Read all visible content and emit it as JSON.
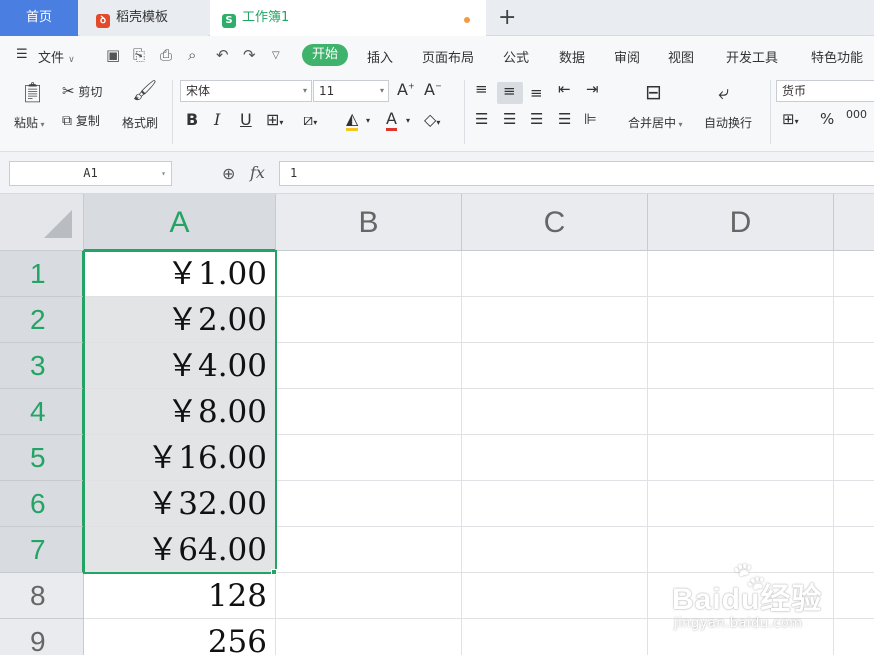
{
  "tabs": {
    "home": "首页",
    "template": "稻壳模板",
    "sheet": "工作簿1",
    "new_tab": "+"
  },
  "menu": {
    "file": "文件",
    "items": [
      "开始",
      "插入",
      "页面布局",
      "公式",
      "数据",
      "审阅",
      "视图",
      "开发工具",
      "特色功能"
    ]
  },
  "ribbon": {
    "paste": "粘贴",
    "cut": "剪切",
    "copy": "复制",
    "format_painter": "格式刷",
    "font_name": "宋体",
    "font_size": "11",
    "merge_center": "合并居中",
    "wrap_text": "自动换行",
    "number_format": "货币",
    "percent": "%",
    "thousands": "000"
  },
  "formula_bar": {
    "name_box": "A1",
    "fx": "fx",
    "value": "1"
  },
  "grid": {
    "columns": [
      "A",
      "B",
      "C",
      "D"
    ],
    "rows": [
      "1",
      "2",
      "3",
      "4",
      "5",
      "6",
      "7",
      "8",
      "9"
    ],
    "column_a_values": [
      "￥1.00",
      "￥2.00",
      "￥4.00",
      "￥8.00",
      "￥16.00",
      "￥32.00",
      "￥64.00",
      "128",
      "256"
    ],
    "selected_range": "A1:A7",
    "accent_color": "#23a464"
  },
  "watermark": {
    "logo": "Baidu经验",
    "url": "jingyan.baidu.com"
  }
}
